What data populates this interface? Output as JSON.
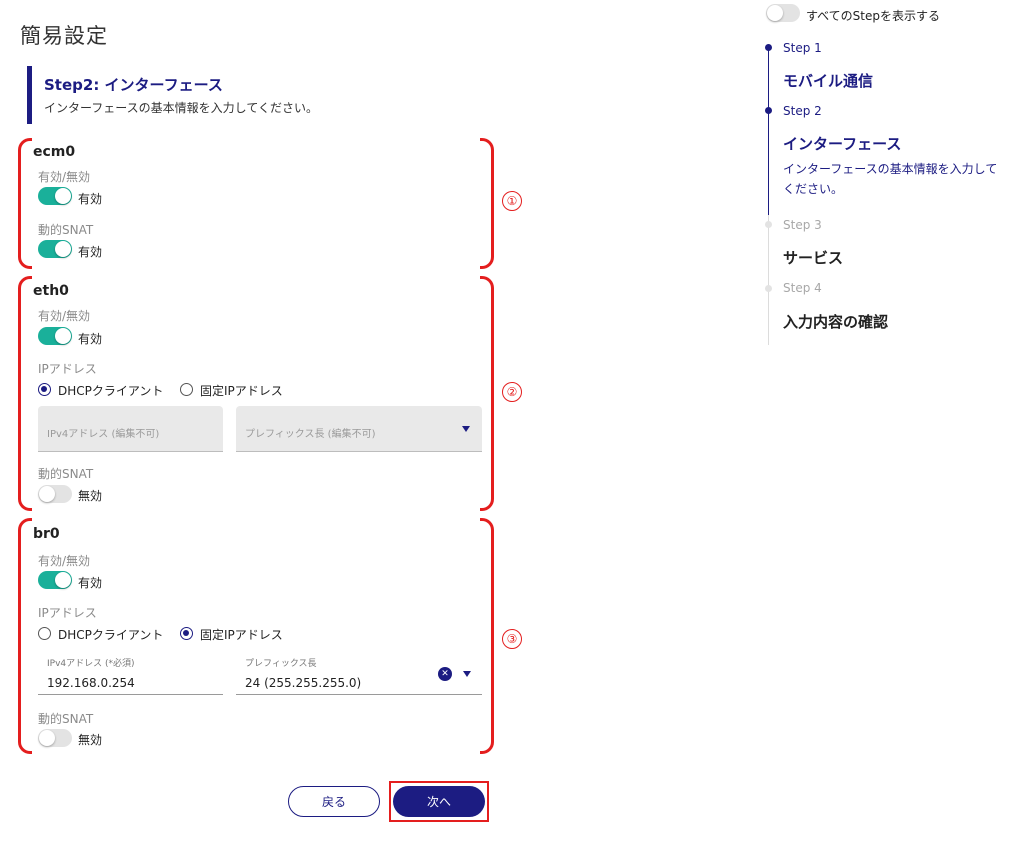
{
  "page": {
    "title": "簡易設定"
  },
  "step_header": {
    "title": "Step2: インターフェース",
    "description": "インターフェースの基本情報を入力してください。"
  },
  "markers": [
    "①",
    "②",
    "③"
  ],
  "interfaces": [
    {
      "name": "ecm0",
      "enabled_label": "有効/無効",
      "enabled_value": "有効",
      "enabled_on": true,
      "snat_label": "動的SNAT",
      "snat_value": "有効",
      "snat_on": true
    },
    {
      "name": "eth0",
      "enabled_label": "有効/無効",
      "enabled_value": "有効",
      "enabled_on": true,
      "ip_label": "IPアドレス",
      "ip_options": [
        "DHCPクライアント",
        "固定IPアドレス"
      ],
      "ip_selected": "DHCPクライアント",
      "ipv4_placeholder": "IPv4アドレス (編集不可)",
      "prefix_placeholder": "プレフィックス長 (編集不可)",
      "snat_label": "動的SNAT",
      "snat_value": "無効",
      "snat_on": false
    },
    {
      "name": "br0",
      "enabled_label": "有効/無効",
      "enabled_value": "有効",
      "enabled_on": true,
      "ip_label": "IPアドレス",
      "ip_options": [
        "DHCPクライアント",
        "固定IPアドレス"
      ],
      "ip_selected": "固定IPアドレス",
      "ipv4_label": "IPv4アドレス (*必須)",
      "ipv4_value": "192.168.0.254",
      "prefix_label": "プレフィックス長",
      "prefix_value": "24 (255.255.255.0)",
      "snat_label": "動的SNAT",
      "snat_value": "無効",
      "snat_on": false
    }
  ],
  "buttons": {
    "back": "戻る",
    "next": "次へ"
  },
  "stepper": {
    "show_all_label": "すべてのStepを表示する",
    "show_all_on": false,
    "steps": [
      {
        "number": "Step 1",
        "name": "モバイル通信",
        "active": true
      },
      {
        "number": "Step 2",
        "name": "インターフェース",
        "active": true,
        "detail": "インターフェースの基本情報を入力してください。"
      },
      {
        "number": "Step 3",
        "name": "サービス",
        "active": false
      },
      {
        "number": "Step 4",
        "name": "入力内容の確認",
        "active": false
      }
    ]
  },
  "colors": {
    "primary": "#1c1c82",
    "toggle_on": "#1ab09a",
    "highlight": "#e41e1e"
  },
  "icons": {
    "clear": "clear-circle-icon",
    "dropdown": "caret-down-icon"
  }
}
